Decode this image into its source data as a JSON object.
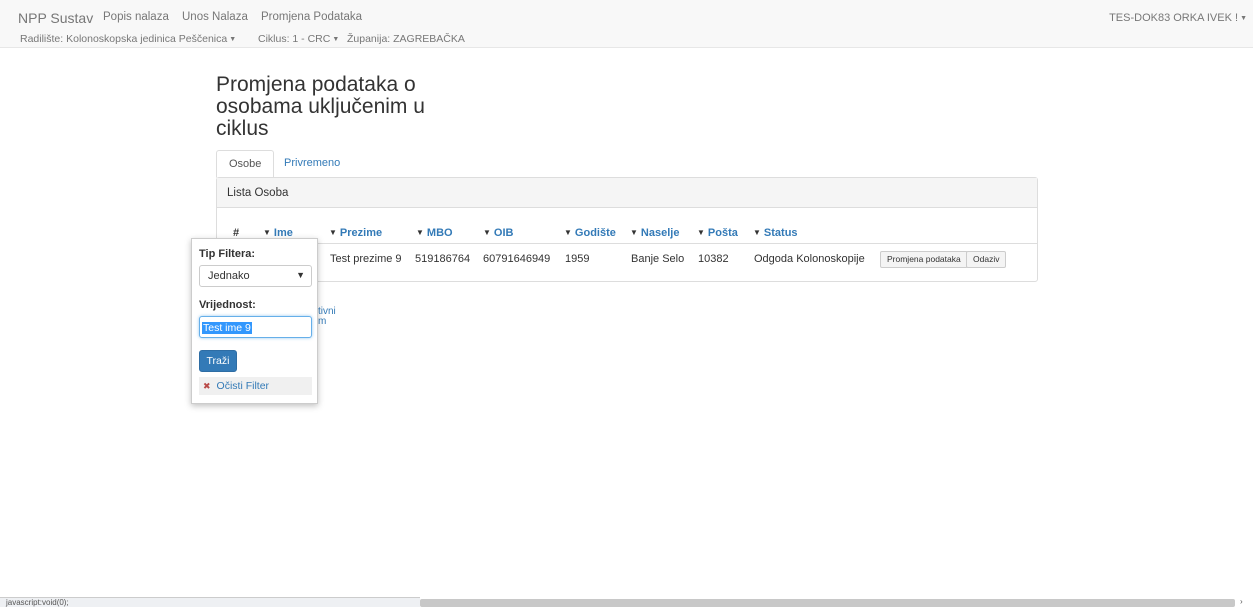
{
  "navbar": {
    "brand": "NPP Sustav",
    "links": [
      "Popis nalaza",
      "Unos Nalaza",
      "Promjena Podataka"
    ],
    "radiliste": "Radilište: Kolonoskopska jedinica Peščenica",
    "ciklus": "Ciklus: 1 - CRC",
    "zupanija": "Županija: ZAGREBAČKA",
    "user": "TES-DOK83 ORKA IVEK !"
  },
  "page": {
    "title": "Promjena podataka o osobama uključenim u ciklus"
  },
  "tabs": [
    {
      "label": "Osobe",
      "active": true
    },
    {
      "label": "Privremeno isključene",
      "active": false
    }
  ],
  "panel": {
    "heading": "Lista Osoba",
    "columns": [
      "#",
      "Ime",
      "Prezime",
      "MBO",
      "OIB",
      "Godište",
      "Naselje",
      "Pošta",
      "Status"
    ],
    "rows": [
      {
        "prezime": "Test prezime 9",
        "mbo": "519186764",
        "oib": "60791646949",
        "godiste": "1959",
        "naselje": "Banje Selo",
        "posta": "10382",
        "status": "Odgoda Kolonoskopije",
        "action1": "Promjena podataka",
        "action2": "Odaziv"
      }
    ]
  },
  "fragments": {
    "line1": "tivni",
    "line2": "m"
  },
  "filter_popup": {
    "type_label": "Tip Filtera:",
    "type_value": "Jednako",
    "value_label": "Vrijednost:",
    "value": "Test ime 9",
    "search_button": "Traži",
    "clear_label": "Očisti Filter"
  },
  "statusbar": {
    "text": "javascript:void(0);"
  },
  "icons": {
    "filter": "filter-icon",
    "caret": "caret-down-icon",
    "clear": "remove-filter-icon"
  },
  "colors": {
    "link": "#337ab7",
    "primary_button": "#337ab7",
    "navbar_bg": "#f8f8f8"
  }
}
